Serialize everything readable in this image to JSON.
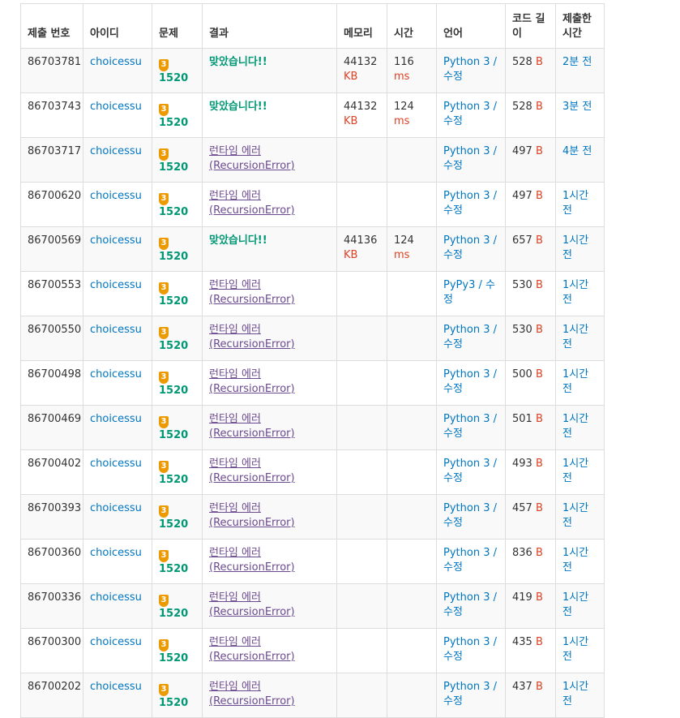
{
  "headers": {
    "submission_id": "제출 번호",
    "user_id": "아이디",
    "problem": "문제",
    "result": "결과",
    "memory": "메모리",
    "time": "시간",
    "language": "언어",
    "code_length": "코드 길이",
    "submitted_time": "제출한 시간"
  },
  "rows": [
    {
      "id": "86703781",
      "user": "choicessu",
      "tier": "3",
      "problem": "1520",
      "result": "맞았습니다!!",
      "result_type": "ok",
      "memory": "44132",
      "memory_unit": "KB",
      "time": "116",
      "time_unit": "ms",
      "lang": "Python 3",
      "edit": "수정",
      "length": "528",
      "length_unit": "B",
      "ago": "2분 전"
    },
    {
      "id": "86703743",
      "user": "choicessu",
      "tier": "3",
      "problem": "1520",
      "result": "맞았습니다!!",
      "result_type": "ok",
      "memory": "44132",
      "memory_unit": "KB",
      "time": "124",
      "time_unit": "ms",
      "lang": "Python 3",
      "edit": "수정",
      "length": "528",
      "length_unit": "B",
      "ago": "3분 전"
    },
    {
      "id": "86703717",
      "user": "choicessu",
      "tier": "3",
      "problem": "1520",
      "result": "런타임 에러 (RecursionError)",
      "result_type": "rte",
      "memory": "",
      "memory_unit": "",
      "time": "",
      "time_unit": "",
      "lang": "Python 3",
      "edit": "수정",
      "length": "497",
      "length_unit": "B",
      "ago": "4분 전"
    },
    {
      "id": "86700620",
      "user": "choicessu",
      "tier": "3",
      "problem": "1520",
      "result": "런타임 에러 (RecursionError)",
      "result_type": "rte",
      "memory": "",
      "memory_unit": "",
      "time": "",
      "time_unit": "",
      "lang": "Python 3",
      "edit": "수정",
      "length": "497",
      "length_unit": "B",
      "ago": "1시간 전"
    },
    {
      "id": "86700569",
      "user": "choicessu",
      "tier": "3",
      "problem": "1520",
      "result": "맞았습니다!!",
      "result_type": "ok",
      "memory": "44136",
      "memory_unit": "KB",
      "time": "124",
      "time_unit": "ms",
      "lang": "Python 3",
      "edit": "수정",
      "length": "657",
      "length_unit": "B",
      "ago": "1시간 전"
    },
    {
      "id": "86700553",
      "user": "choicessu",
      "tier": "3",
      "problem": "1520",
      "result": "런타임 에러 (RecursionError)",
      "result_type": "rte",
      "memory": "",
      "memory_unit": "",
      "time": "",
      "time_unit": "",
      "lang": "PyPy3",
      "edit": "수정",
      "length": "530",
      "length_unit": "B",
      "ago": "1시간 전"
    },
    {
      "id": "86700550",
      "user": "choicessu",
      "tier": "3",
      "problem": "1520",
      "result": "런타임 에러 (RecursionError)",
      "result_type": "rte",
      "memory": "",
      "memory_unit": "",
      "time": "",
      "time_unit": "",
      "lang": "Python 3",
      "edit": "수정",
      "length": "530",
      "length_unit": "B",
      "ago": "1시간 전"
    },
    {
      "id": "86700498",
      "user": "choicessu",
      "tier": "3",
      "problem": "1520",
      "result": "런타임 에러 (RecursionError)",
      "result_type": "rte",
      "memory": "",
      "memory_unit": "",
      "time": "",
      "time_unit": "",
      "lang": "Python 3",
      "edit": "수정",
      "length": "500",
      "length_unit": "B",
      "ago": "1시간 전"
    },
    {
      "id": "86700469",
      "user": "choicessu",
      "tier": "3",
      "problem": "1520",
      "result": "런타임 에러 (RecursionError)",
      "result_type": "rte",
      "memory": "",
      "memory_unit": "",
      "time": "",
      "time_unit": "",
      "lang": "Python 3",
      "edit": "수정",
      "length": "501",
      "length_unit": "B",
      "ago": "1시간 전"
    },
    {
      "id": "86700402",
      "user": "choicessu",
      "tier": "3",
      "problem": "1520",
      "result": "런타임 에러 (RecursionError)",
      "result_type": "rte",
      "memory": "",
      "memory_unit": "",
      "time": "",
      "time_unit": "",
      "lang": "Python 3",
      "edit": "수정",
      "length": "493",
      "length_unit": "B",
      "ago": "1시간 전"
    },
    {
      "id": "86700393",
      "user": "choicessu",
      "tier": "3",
      "problem": "1520",
      "result": "런타임 에러 (RecursionError)",
      "result_type": "rte",
      "memory": "",
      "memory_unit": "",
      "time": "",
      "time_unit": "",
      "lang": "Python 3",
      "edit": "수정",
      "length": "457",
      "length_unit": "B",
      "ago": "1시간 전"
    },
    {
      "id": "86700360",
      "user": "choicessu",
      "tier": "3",
      "problem": "1520",
      "result": "런타임 에러 (RecursionError)",
      "result_type": "rte",
      "memory": "",
      "memory_unit": "",
      "time": "",
      "time_unit": "",
      "lang": "Python 3",
      "edit": "수정",
      "length": "836",
      "length_unit": "B",
      "ago": "1시간 전"
    },
    {
      "id": "86700336",
      "user": "choicessu",
      "tier": "3",
      "problem": "1520",
      "result": "런타임 에러 (RecursionError)",
      "result_type": "rte",
      "memory": "",
      "memory_unit": "",
      "time": "",
      "time_unit": "",
      "lang": "Python 3",
      "edit": "수정",
      "length": "419",
      "length_unit": "B",
      "ago": "1시간 전"
    },
    {
      "id": "86700300",
      "user": "choicessu",
      "tier": "3",
      "problem": "1520",
      "result": "런타임 에러 (RecursionError)",
      "result_type": "rte",
      "memory": "",
      "memory_unit": "",
      "time": "",
      "time_unit": "",
      "lang": "Python 3",
      "edit": "수정",
      "length": "435",
      "length_unit": "B",
      "ago": "1시간 전"
    },
    {
      "id": "86700202",
      "user": "choicessu",
      "tier": "3",
      "problem": "1520",
      "result": "런타임 에러 (RecursionError)",
      "result_type": "rte",
      "memory": "",
      "memory_unit": "",
      "time": "",
      "time_unit": "",
      "lang": "Python 3",
      "edit": "수정",
      "length": "437",
      "length_unit": "B",
      "ago": "1시간 전"
    }
  ],
  "colors": {
    "link": "#0076c0",
    "accepted": "#009874",
    "runtime_error": "#6c4a8f",
    "unit": "#dd4124",
    "tier_gold": "#ec9a00",
    "border": "#dddddd",
    "stripe": "#f9f9f9"
  },
  "icons": {
    "tier_badge": "gold-tier-badge-icon"
  }
}
